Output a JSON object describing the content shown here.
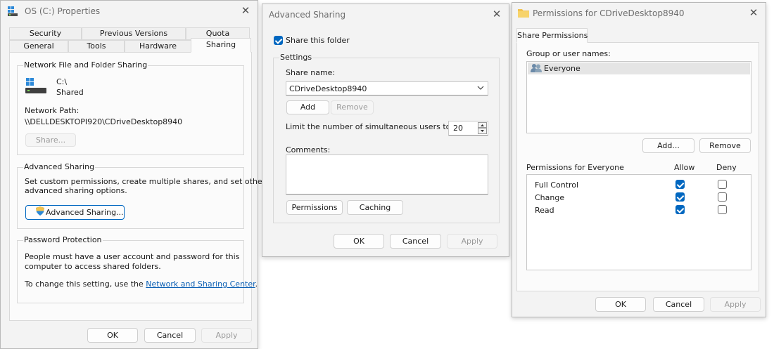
{
  "props": {
    "title": "OS (C:) Properties",
    "tabs_row1": [
      "Security",
      "Previous Versions",
      "Quota"
    ],
    "tabs_row2": [
      "General",
      "Tools",
      "Hardware",
      "Sharing"
    ],
    "network_group": "Network File and Folder Sharing",
    "drive_name": "C:\\",
    "drive_status": "Shared",
    "network_path_label": "Network Path:",
    "network_path": "\\\\DELLDESKTOPI920\\CDriveDesktop8940",
    "share_button": "Share...",
    "advanced_group": "Advanced Sharing",
    "advanced_desc_1": "Set custom permissions, create multiple shares, and set other",
    "advanced_desc_2": "advanced sharing options.",
    "advanced_button": "Advanced Sharing...",
    "password_group": "Password Protection",
    "password_desc_1": "People must have a user account and password for this",
    "password_desc_2": "computer to access shared folders.",
    "password_change_prefix": "To change this setting, use the ",
    "password_link": "Network and Sharing Center",
    "password_change_suffix": ".",
    "ok": "OK",
    "cancel": "Cancel",
    "apply": "Apply"
  },
  "advanced": {
    "title": "Advanced Sharing",
    "share_checkbox_label": "Share this folder",
    "share_checked": true,
    "settings_group": "Settings",
    "share_name_label": "Share name:",
    "share_name_value": "CDriveDesktop8940",
    "add": "Add",
    "remove": "Remove",
    "limit_label": "Limit the number of simultaneous users to:",
    "limit_value": "20",
    "comments_label": "Comments:",
    "comments_value": "",
    "permissions": "Permissions",
    "caching": "Caching",
    "ok": "OK",
    "cancel": "Cancel",
    "apply": "Apply"
  },
  "permissions": {
    "title": "Permissions for CDriveDesktop8940",
    "tab": "Share Permissions",
    "group_label": "Group or user names:",
    "users": [
      "Everyone"
    ],
    "add": "Add...",
    "remove": "Remove",
    "perm_header": "Permissions for Everyone",
    "allow_header": "Allow",
    "deny_header": "Deny",
    "rows": [
      {
        "name": "Full Control",
        "allow": true,
        "deny": false
      },
      {
        "name": "Change",
        "allow": true,
        "deny": false
      },
      {
        "name": "Read",
        "allow": true,
        "deny": false
      }
    ],
    "ok": "OK",
    "cancel": "Cancel",
    "apply": "Apply"
  },
  "colors": {
    "accent": "#0067c0",
    "link": "#0a5fb4",
    "folder": "#f2c24e"
  }
}
